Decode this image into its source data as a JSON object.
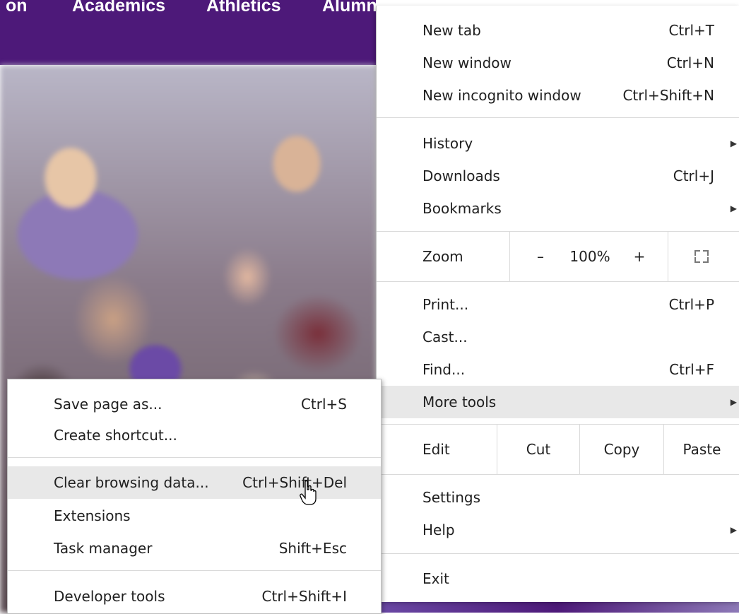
{
  "site_nav": {
    "items": [
      "on",
      "Academics",
      "Athletics",
      "Alumni"
    ]
  },
  "main_menu": {
    "new_tab": {
      "label": "New tab",
      "shortcut": "Ctrl+T"
    },
    "new_window": {
      "label": "New window",
      "shortcut": "Ctrl+N"
    },
    "new_incognito": {
      "label": "New incognito window",
      "shortcut": "Ctrl+Shift+N"
    },
    "history": {
      "label": "History"
    },
    "downloads": {
      "label": "Downloads",
      "shortcut": "Ctrl+J"
    },
    "bookmarks": {
      "label": "Bookmarks"
    },
    "zoom": {
      "label": "Zoom",
      "minus": "–",
      "value": "100%",
      "plus": "+"
    },
    "print": {
      "label": "Print...",
      "shortcut": "Ctrl+P"
    },
    "cast": {
      "label": "Cast..."
    },
    "find": {
      "label": "Find...",
      "shortcut": "Ctrl+F"
    },
    "more_tools": {
      "label": "More tools"
    },
    "edit": {
      "label": "Edit",
      "cut": "Cut",
      "copy": "Copy",
      "paste": "Paste"
    },
    "settings": {
      "label": "Settings"
    },
    "help": {
      "label": "Help"
    },
    "exit": {
      "label": "Exit"
    }
  },
  "sub_menu": {
    "save_page": {
      "label": "Save page as...",
      "shortcut": "Ctrl+S"
    },
    "create_shortcut": {
      "label": "Create shortcut..."
    },
    "clear_browsing": {
      "label": "Clear browsing data...",
      "shortcut": "Ctrl+Shift+Del"
    },
    "extensions": {
      "label": "Extensions"
    },
    "task_manager": {
      "label": "Task manager",
      "shortcut": "Shift+Esc"
    },
    "developer_tools": {
      "label": "Developer tools",
      "shortcut": "Ctrl+Shift+I"
    }
  },
  "colors": {
    "site_purple": "#4d1979",
    "menu_highlight": "#e8e8e8",
    "separator": "#dadada"
  }
}
